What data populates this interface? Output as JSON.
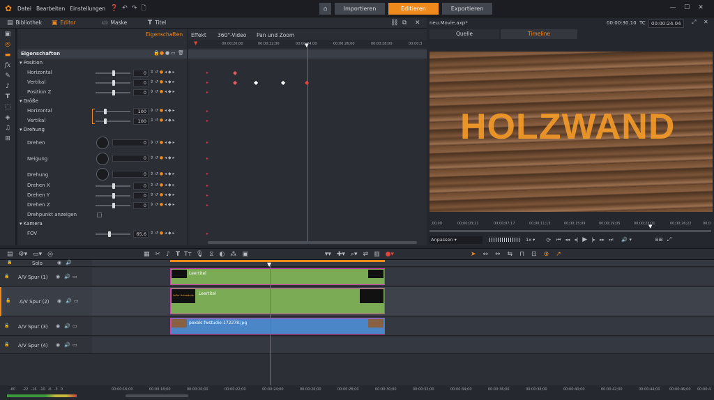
{
  "menu": {
    "items": [
      "Datei",
      "Bearbeiten",
      "Einstellungen"
    ]
  },
  "modes": {
    "import": "Importieren",
    "edit": "Editieren",
    "export": "Exportieren"
  },
  "tabs": {
    "library": "Bibliothek",
    "editor": "Editor",
    "mask": "Maske",
    "title": "Titel"
  },
  "subtabs": {
    "props": "Eigenschaften",
    "effect": "Effekt",
    "video360": "360°-Video",
    "panzoom": "Pan und Zoom"
  },
  "props": {
    "header": "Eigenschaften",
    "position": "Position",
    "horizontal": "Horizontal",
    "vertikal": "Vertikal",
    "posz": "Position Z",
    "groesse": "Größe",
    "g_horizontal": "Horizontal",
    "g_vertikal": "Vertikal",
    "drehung": "Drehung",
    "drehen": "Drehen",
    "neigung": "Neigung",
    "drehung2": "Drehung",
    "drehenx": "Drehen X",
    "dreheny": "Drehen Y",
    "drehenz": "Drehen Z",
    "drehpunkt": "Drehpunkt anzeigen",
    "kamera": "Kamera",
    "fov": "FOV",
    "v_h": "0",
    "v_v": "0",
    "v_z": "0",
    "v_gh": "100",
    "v_gv": "100",
    "v_dr": "0",
    "v_ne": "0",
    "v_dr2": "0",
    "v_dx": "0",
    "v_dy": "0",
    "v_dz": "0",
    "v_fov": "65,6"
  },
  "kfruler": [
    "00:00:20;00",
    "00:00:22;00",
    "00:00:24;00",
    "00:00:26;00",
    "00:00:28;00",
    "00:00:3"
  ],
  "preview": {
    "file": "neu.Movie.axp*",
    "time1": "00:00:30.10",
    "tc_label": "TC",
    "tc": "00:00:24.04",
    "tab_source": "Quelle",
    "tab_timeline": "Timeline",
    "overlay": "HOLZWAND",
    "ruler": [
      ",00,00",
      "00;00;03;21",
      "00;00;07;17",
      "00;00;11;13",
      "00;00;15;09",
      "00;00;19;05",
      "00;00;23;01",
      "00;00;26;22",
      "00;0"
    ],
    "fit": "Anpassen",
    "speed": "1x",
    "pip": "BiB"
  },
  "tracks": {
    "solo": "Solo",
    "list": [
      {
        "name": "A/V Spur (1)",
        "clip": "Leertitel"
      },
      {
        "name": "A/V Spur (2)",
        "clip": "Leertitel",
        "thumb": "LoPer Holzwände"
      },
      {
        "name": "A/V Spur (3)",
        "clip": "pexels-fwstudio-172278.jpg"
      },
      {
        "name": "A/V Spur (4)",
        "clip": ""
      }
    ]
  },
  "bottomruler": [
    "00:00:16;00",
    "00:00:18;00",
    "00:00:20;00",
    "00:00:22;00",
    "00:00:24;00",
    "00:00:26;00",
    "00:00:28;00",
    "00:00:30;00",
    "00:00:32;00",
    "00:00:34;00",
    "00:00:36;00",
    "00:00:38;00",
    "00:00:40;00",
    "00:00:42;00",
    "00:00:44;00",
    "00:00:46;00",
    "00:00:4"
  ],
  "audiometer": [
    "-60",
    "-22",
    "-16",
    "-10",
    "-6",
    "-3",
    "0"
  ]
}
